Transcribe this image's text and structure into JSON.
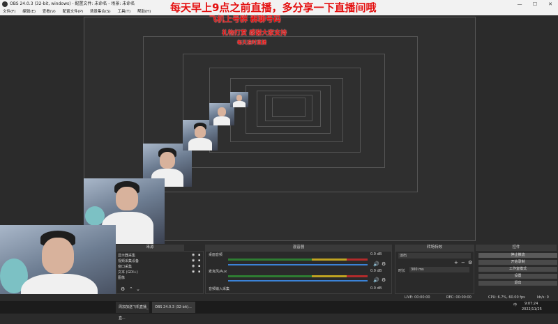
{
  "window": {
    "title": "OBS 24.0.3 (32-bit, windows) - 配置文件: 未命名 - 场景: 未命名",
    "min": "—",
    "max": "☐",
    "close": "✕"
  },
  "menu": [
    "文件(F)",
    "编辑(E)",
    "查看(V)",
    "配置文件(P)",
    "场景集合(S)",
    "工具(T)",
    "帮助(H)"
  ],
  "overlay": {
    "line1": "每天早上9点之前直播，多分享一下直播间哦",
    "line2": "飞机上号群 群聊号码",
    "line3": "礼物打赏 感谢大家支持",
    "line4": "每天准时直播"
  },
  "docks": {
    "sources": "来源",
    "mixer": "混音器",
    "transitions": "转场特效",
    "controls": "控件"
  },
  "sources": {
    "items": [
      "显示器采集",
      "视频采集设备",
      "窗口采集",
      "文本 (GDI+)",
      "图像"
    ]
  },
  "mixer": {
    "channels": [
      {
        "name": "桌面音频",
        "db": "0.0 dB"
      },
      {
        "name": "麦克风/Aux",
        "db": "0.0 dB"
      },
      {
        "name": "音频输入采集",
        "db": "0.0 dB"
      }
    ]
  },
  "transitions": {
    "selected": "淡出",
    "duration_label": "时长",
    "duration_value": "300 ms"
  },
  "controls": {
    "buttons": [
      "停止推流",
      "开始录制",
      "工作室模式",
      "设置",
      "退出"
    ]
  },
  "status": {
    "live": "LIVE: 00:00:00",
    "rec": "REC: 00:00:00",
    "cpu": "CPU: 6.7%, 60.00 fps",
    "kbps": "kb/s: 0"
  },
  "taskbar": {
    "items": [
      "周加加送飞机直播_直...",
      "OBS 24.0.3 (32-bit)..."
    ],
    "time": "9:07:24",
    "date": "2022/11/25",
    "lang": "中"
  }
}
